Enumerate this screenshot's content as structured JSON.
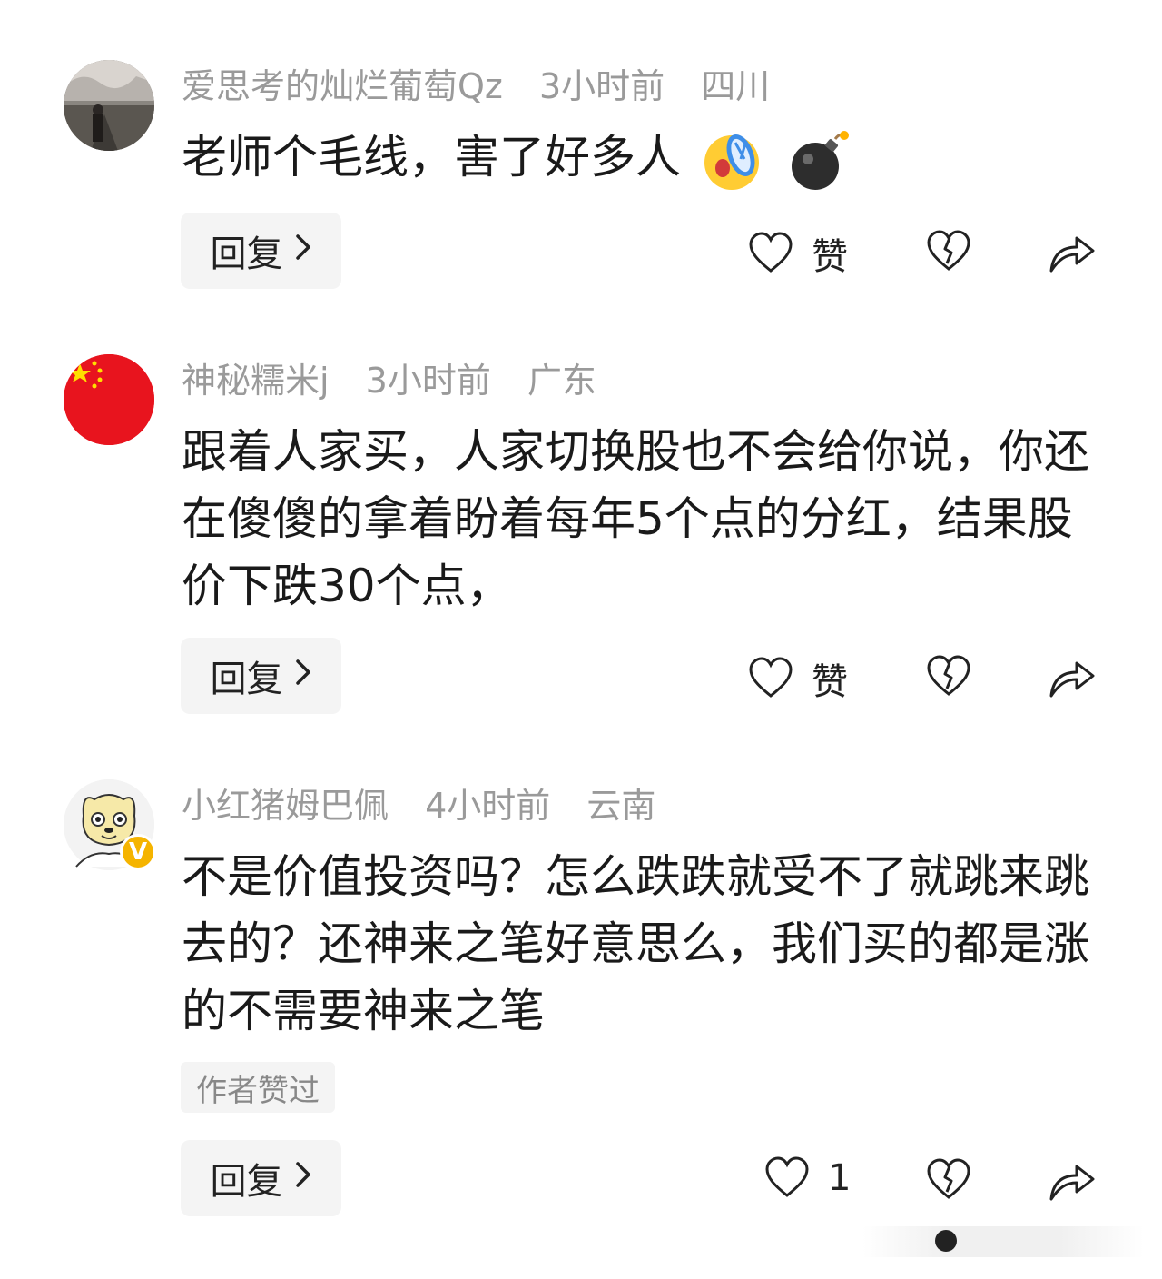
{
  "comments": [
    {
      "username": "爱思考的灿烂葡萄Qz",
      "time": "3小时前",
      "location": "四川",
      "text": "老师个毛线，害了好多人",
      "emojis": [
        "face-with-sandal-icon",
        "bomb-icon"
      ],
      "reply_label": "回复",
      "like_label": "赞"
    },
    {
      "username": "神秘糯米j",
      "time": "3小时前",
      "location": "广东",
      "text": "跟着人家买，人家切换股也不会给你说，你还在傻傻的拿着盼着每年5个点的分红，结果股价下跌30个点，",
      "reply_label": "回复",
      "like_label": "赞"
    },
    {
      "username": "小红猪姆巴佩",
      "time": "4小时前",
      "location": "云南",
      "text": "不是价值投资吗？怎么跌跌就受不了就跳来跳去的？还神来之笔好意思么，我们买的都是涨的不需要神来之笔",
      "badge": "V",
      "author_liked_label": "作者赞过",
      "reply_label": "回复",
      "like_count": "1"
    }
  ],
  "colors": {
    "meta_gray": "#9a9a9a",
    "reply_bg": "#f4f4f4",
    "verified_badge": "#f5b400",
    "flag_red": "#e8141e",
    "flag_star": "#ffde00"
  }
}
